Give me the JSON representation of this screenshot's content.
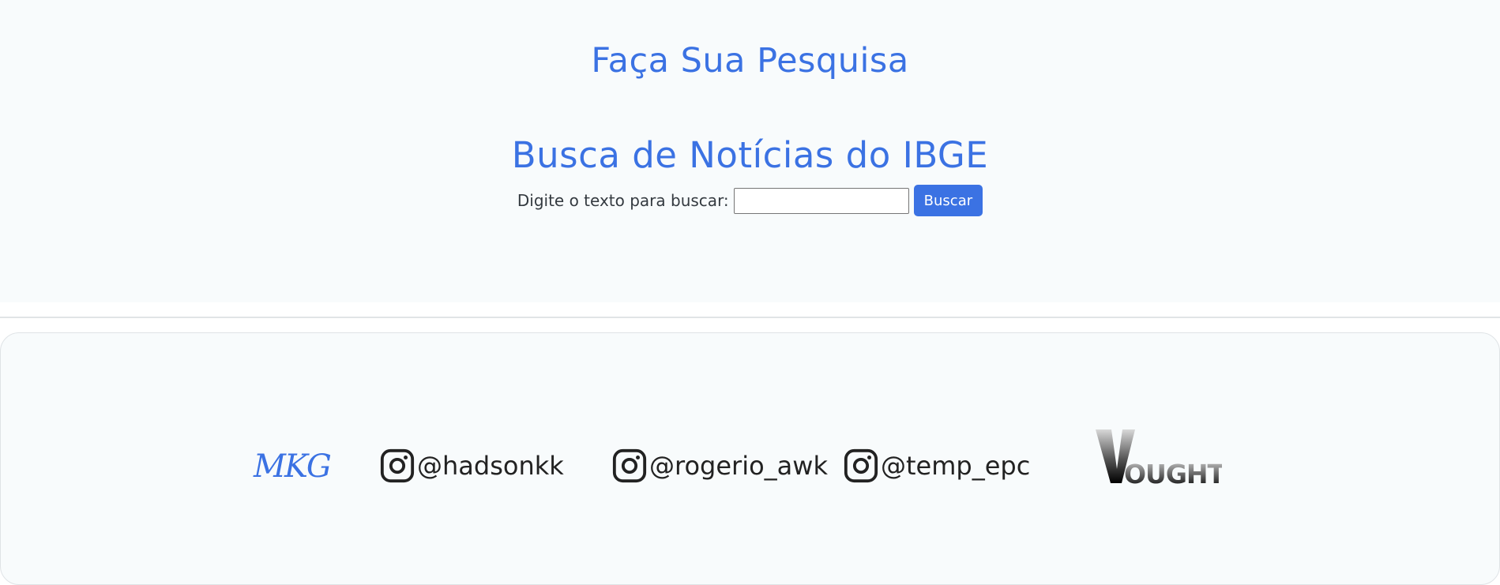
{
  "search": {
    "page_title": "Faça Sua Pesquisa",
    "heading": "Busca de Notícias do IBGE",
    "label": "Digite o texto para buscar:",
    "input_value": "",
    "button_label": "Buscar"
  },
  "footer": {
    "brand_logo": "MKG",
    "socials": [
      {
        "icon": "instagram-icon",
        "handle": "@hadsonkk"
      },
      {
        "icon": "instagram-icon",
        "handle": "@rogerio_awk"
      },
      {
        "icon": "instagram-icon",
        "handle": "@temp_epc"
      }
    ],
    "partner_logo": "VOUGHT"
  },
  "colors": {
    "accent": "#3b72e3",
    "background": "#f8fbfc",
    "text": "#222222"
  }
}
